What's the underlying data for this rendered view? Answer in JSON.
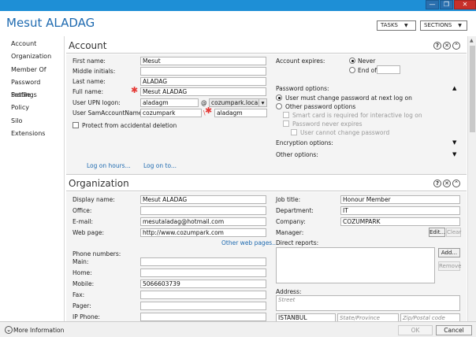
{
  "window": {
    "title": "Mesut ALADAG",
    "minimize": "—",
    "restore": "❐",
    "close": "✕"
  },
  "header": {
    "tasks": "TASKS",
    "sections": "SECTIONS"
  },
  "sidebar": {
    "items": [
      {
        "label": "Account"
      },
      {
        "label": "Organization"
      },
      {
        "label": "Member Of"
      },
      {
        "label": "Password Settings"
      },
      {
        "label": "Profile"
      },
      {
        "label": "Policy"
      },
      {
        "label": "Silo"
      },
      {
        "label": "Extensions"
      }
    ]
  },
  "icons": {
    "help": "?",
    "collapse": "⌃",
    "close": "✕"
  },
  "account": {
    "title": "Account",
    "first_name_label": "First name:",
    "first_name": "Mesut",
    "middle_label": "Middle initials:",
    "middle": "",
    "last_name_label": "Last name:",
    "last_name": "ALADAG",
    "full_name_label": "Full name:",
    "full_name": "Mesut ALADAG",
    "upn_label": "User UPN logon:",
    "upn_user": "aladagm",
    "upn_at": "@",
    "upn_domain": "cozumpark.local",
    "sam_label": "User SamAccountName l...",
    "sam_domain": "cozumpark",
    "sam_sep": "\\",
    "sam_user": "aladagm",
    "protect_label": "Protect from accidental deletion",
    "logon_hours": "Log on hours...",
    "logon_to": "Log on to...",
    "expires_label": "Account expires:",
    "never": "Never",
    "end_of": "End of",
    "pw_options_label": "Password options:",
    "pw_must_change": "User must change password at next log on",
    "pw_other": "Other password options",
    "smart_card": "Smart card is required for interactive log on",
    "never_expires": "Password never expires",
    "cannot_change": "User cannot change password",
    "encryption": "Encryption options:",
    "other": "Other options:"
  },
  "organization": {
    "title": "Organization",
    "display_name_label": "Display name:",
    "display_name": "Mesut ALADAG",
    "office_label": "Office:",
    "office": "",
    "email_label": "E-mail:",
    "email": "mesutaladag@hotmail.com",
    "web_label": "Web page:",
    "web": "http://www.cozumpark.com",
    "other_web": "Other web pages...",
    "phones_label": "Phone numbers:",
    "main_label": "Main:",
    "main": "",
    "home_label": "Home:",
    "home": "",
    "mobile_label": "Mobile:",
    "mobile": "5066603739",
    "fax_label": "Fax:",
    "fax": "",
    "pager_label": "Pager:",
    "pager": "",
    "ipphone_label": "IP Phone:",
    "ipphone": "",
    "job_label": "Job title:",
    "job": "Honour Member",
    "dept_label": "Department:",
    "dept": "IT",
    "company_label": "Company:",
    "company": "COZUMPARK",
    "manager_label": "Manager:",
    "edit": "Edit...",
    "clear": "Clear",
    "direct_label": "Direct reports:",
    "add": "Add...",
    "remove": "Remove",
    "address_label": "Address:",
    "street_ph": "Street",
    "city": "ISTANBUL",
    "state_ph": "State/Province",
    "zip_ph": "Zip/Postal code"
  },
  "footer": {
    "more_info": "More Information",
    "ok": "OK",
    "cancel": "Cancel"
  }
}
